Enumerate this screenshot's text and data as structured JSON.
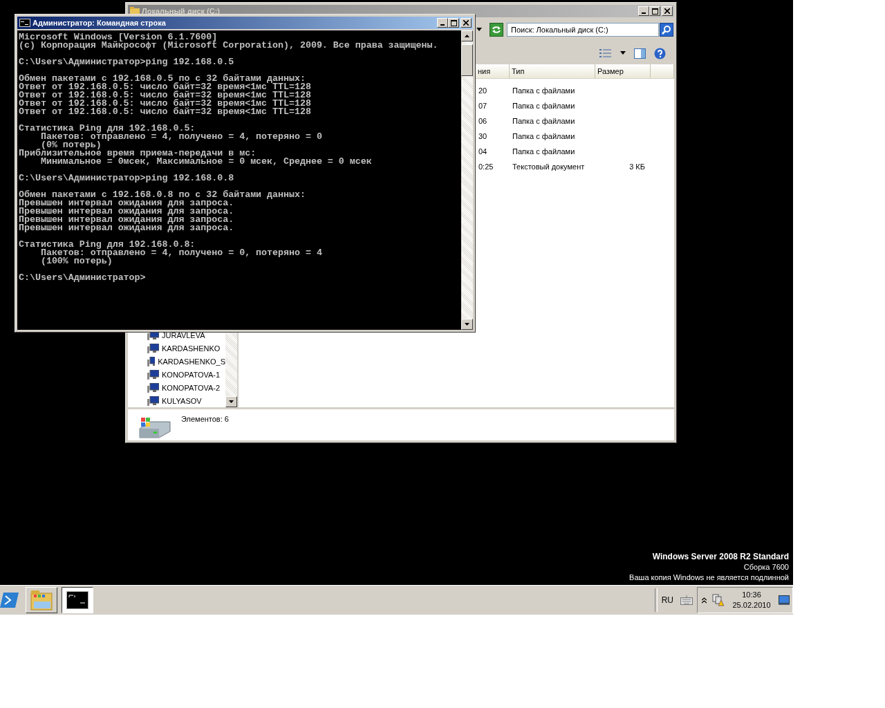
{
  "explorer_window": {
    "title": "Локальный диск (C:)",
    "active": false,
    "search": {
      "placeholder": "Поиск: Локальный диск (C:)"
    },
    "columns": [
      "ния",
      "Тип",
      "Размер"
    ],
    "rows": [
      {
        "column_1": "20",
        "type": "Папка с файлами"
      },
      {
        "column_1": "07",
        "type": "Папка с файлами"
      },
      {
        "column_1": "06",
        "type": "Папка с файлами"
      },
      {
        "column_1": "30",
        "type": "Папка с файлами"
      },
      {
        "column_1": "04",
        "type": "Папка с файлами"
      },
      {
        "column_1": "0:25",
        "type": "Текстовый документ",
        "size": "3 КБ"
      }
    ],
    "nav_items": [
      "JURAVLEVA",
      "KARDASHENKO",
      "KARDASHENKO_S",
      "KONOPATOVA-1",
      "KONOPATOVA-2",
      "KULYASOV"
    ],
    "status": "Элементов: 6"
  },
  "console_window": {
    "title": "Администратор: Командная строка",
    "active": true,
    "blocks": [
      [
        "Microsoft Windows [Version 6.1.7600]",
        "(c) Корпорация Майкрософт (Microsoft Corporation), 2009. Все права защищены."
      ],
      [
        "C:\\Users\\Администратор>ping 192.168.0.5"
      ],
      [
        "Обмен пакетами с 192.168.0.5 по с 32 байтами данных:",
        "Ответ от 192.168.0.5: число байт=32 время<1мс TTL=128",
        "Ответ от 192.168.0.5: число байт=32 время<1мс TTL=128",
        "Ответ от 192.168.0.5: число байт=32 время<1мс TTL=128",
        "Ответ от 192.168.0.5: число байт=32 время<1мс TTL=128"
      ],
      [
        "Статистика Ping для 192.168.0.5:",
        "    Пакетов: отправлено = 4, получено = 4, потеряно = 0",
        "    (0% потерь)",
        "Приблизительное время приема-передачи в мс:",
        "    Минимальное = 0мсек, Максимальное = 0 мсек, Среднее = 0 мсек"
      ],
      [
        "C:\\Users\\Администратор>ping 192.168.0.8"
      ],
      [
        "Обмен пакетами с 192.168.0.8 по с 32 байтами данных:",
        "Превышен интервал ожидания для запроса.",
        "Превышен интервал ожидания для запроса.",
        "Превышен интервал ожидания для запроса.",
        "Превышен интервал ожидания для запроса."
      ],
      [
        "Статистика Ping для 192.168.0.8:",
        "    Пакетов: отправлено = 4, получено = 0, потеряно = 4",
        "    (100% потерь)"
      ],
      [
        "C:\\Users\\Администратор>"
      ]
    ]
  },
  "desktop_text": [
    "Windows Server 2008 R2 Standard",
    "Сборка 7600",
    "Ваша копия Windows не является подлинной"
  ],
  "taskbar": {
    "buttons": [
      {
        "kind": "explorer",
        "selected": false
      },
      {
        "kind": "console",
        "selected": true
      }
    ],
    "language": "RU",
    "clock": {
      "time": "10:36",
      "date": "25.02.2010"
    }
  }
}
